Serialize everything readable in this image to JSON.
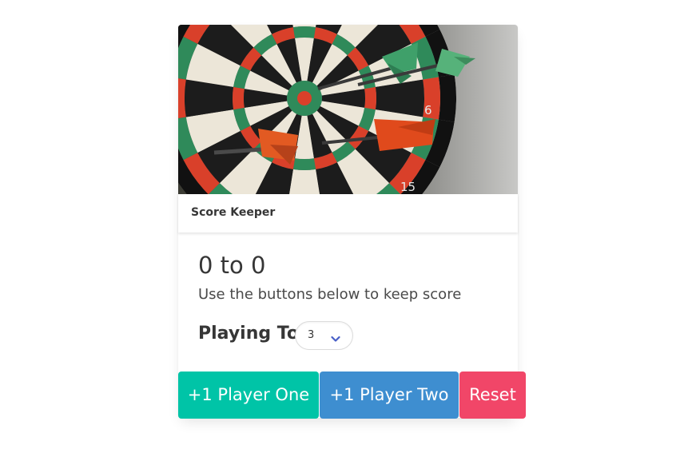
{
  "card": {
    "header_title": "Score Keeper",
    "image_alt_icon": "dartboard-photo"
  },
  "score": {
    "title": "0 to 0",
    "subtitle": "Use the buttons below to keep score"
  },
  "playing_to": {
    "label": "Playing To",
    "selected": "3"
  },
  "buttons": {
    "player_one": "+1 Player One",
    "player_two": "+1 Player Two",
    "reset": "Reset"
  },
  "colors": {
    "player_one": "#00c4a7",
    "player_two": "#3e8ed0",
    "reset": "#f14668",
    "chevron": "#485fc7"
  },
  "board_numbers": [
    "6",
    "15"
  ]
}
